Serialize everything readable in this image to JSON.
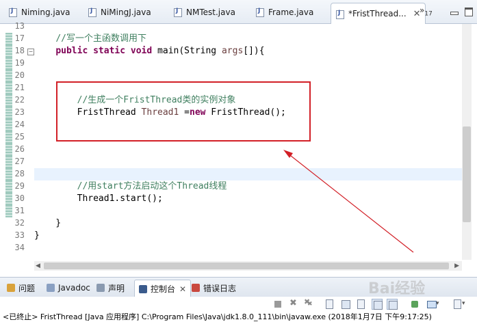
{
  "editor_tabs": [
    {
      "label": "Niming.java",
      "active": false
    },
    {
      "label": "NiMingJ.java",
      "active": false
    },
    {
      "label": "NMTest.java",
      "active": false
    },
    {
      "label": "Frame.java",
      "active": false
    },
    {
      "label": "*FristThread...",
      "active": true
    }
  ],
  "tab_overflow": {
    "symbol": "»",
    "count": "17"
  },
  "code_lines": [
    {
      "num": "13",
      "tokens": []
    },
    {
      "num": "17",
      "tokens": [
        {
          "t": "    ",
          "c": "plain"
        },
        {
          "t": "//写一个主函数调用下",
          "c": "cmt"
        }
      ]
    },
    {
      "num": "18",
      "fold": "⊖",
      "tokens": [
        {
          "t": "    ",
          "c": "plain"
        },
        {
          "t": "public",
          "c": "kw"
        },
        {
          "t": " ",
          "c": "plain"
        },
        {
          "t": "static",
          "c": "kw"
        },
        {
          "t": " ",
          "c": "plain"
        },
        {
          "t": "void",
          "c": "kw"
        },
        {
          "t": " main(String ",
          "c": "plain"
        },
        {
          "t": "args",
          "c": "var"
        },
        {
          "t": "[]){",
          "c": "plain"
        }
      ]
    },
    {
      "num": "19",
      "tokens": []
    },
    {
      "num": "20",
      "tokens": []
    },
    {
      "num": "21",
      "tokens": []
    },
    {
      "num": "22",
      "tokens": [
        {
          "t": "        ",
          "c": "plain"
        },
        {
          "t": "//生成一个FristThread类的实例对象",
          "c": "cmt"
        }
      ]
    },
    {
      "num": "23",
      "tokens": [
        {
          "t": "        FristThread ",
          "c": "plain"
        },
        {
          "t": "Thread1",
          "c": "var"
        },
        {
          "t": " =",
          "c": "plain"
        },
        {
          "t": "new",
          "c": "kw"
        },
        {
          "t": " FristThread();",
          "c": "plain"
        }
      ]
    },
    {
      "num": "24",
      "tokens": []
    },
    {
      "num": "25",
      "tokens": []
    },
    {
      "num": "26",
      "tokens": []
    },
    {
      "num": "27",
      "tokens": []
    },
    {
      "num": "28",
      "tokens": [],
      "current": true
    },
    {
      "num": "29",
      "tokens": [
        {
          "t": "        ",
          "c": "plain"
        },
        {
          "t": "//用start方法启动这个Thread线程",
          "c": "cmt"
        }
      ]
    },
    {
      "num": "30",
      "tokens": [
        {
          "t": "        Thread1.start();",
          "c": "plain"
        }
      ]
    },
    {
      "num": "31",
      "tokens": []
    },
    {
      "num": "32",
      "tokens": [
        {
          "t": "    }",
          "c": "plain"
        }
      ]
    },
    {
      "num": "33",
      "tokens": [
        {
          "t": "}",
          "c": "plain"
        }
      ]
    },
    {
      "num": "34",
      "tokens": []
    }
  ],
  "view_tabs": [
    {
      "label": "问题",
      "icon": "problems-icon",
      "color": "#d9a23b",
      "active": false
    },
    {
      "label": "Javadoc",
      "icon": "javadoc-icon",
      "color": "#8aa0c2",
      "active": false
    },
    {
      "label": "声明",
      "icon": "declaration-icon",
      "color": "#8a9ab0",
      "active": false
    },
    {
      "label": "控制台",
      "icon": "console-icon",
      "color": "#3b5b8c",
      "active": true
    },
    {
      "label": "错误日志",
      "icon": "error-log-icon",
      "color": "#c9483f",
      "active": false
    }
  ],
  "console_status": "<已终止> FristThread [Java 应用程序] C:\\Program Files\\Java\\jdk1.8.0_111\\bin\\javaw.exe (2018年1月7日 下午9:17:25)",
  "colors": {
    "annotation_box": "#d21f26",
    "comment": "#3f7f5f",
    "keyword": "#7f0055",
    "variable": "#6a3e3e",
    "current_line": "#e8f2fe"
  }
}
